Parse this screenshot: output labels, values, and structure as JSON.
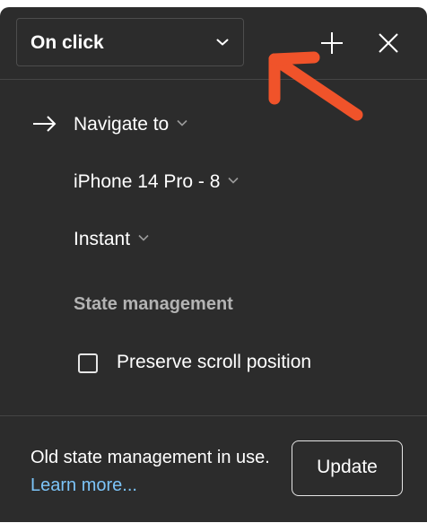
{
  "header": {
    "trigger_label": "On click",
    "add_icon": "plus-icon",
    "close_icon": "close-icon"
  },
  "action": {
    "type_label": "Navigate to",
    "destination_label": "iPhone 14 Pro - 8",
    "animation_label": "Instant",
    "action_icon": "arrow-right-icon"
  },
  "state_management": {
    "title": "State management",
    "preserve_scroll_label": "Preserve scroll position",
    "preserve_scroll_checked": false
  },
  "footer": {
    "message": "Old state management in use.",
    "link_text": "Learn more...",
    "update_label": "Update"
  },
  "colors": {
    "panel_bg": "#2c2c2c",
    "link": "#7cc4f8",
    "annotation_arrow": "#f0532a"
  }
}
